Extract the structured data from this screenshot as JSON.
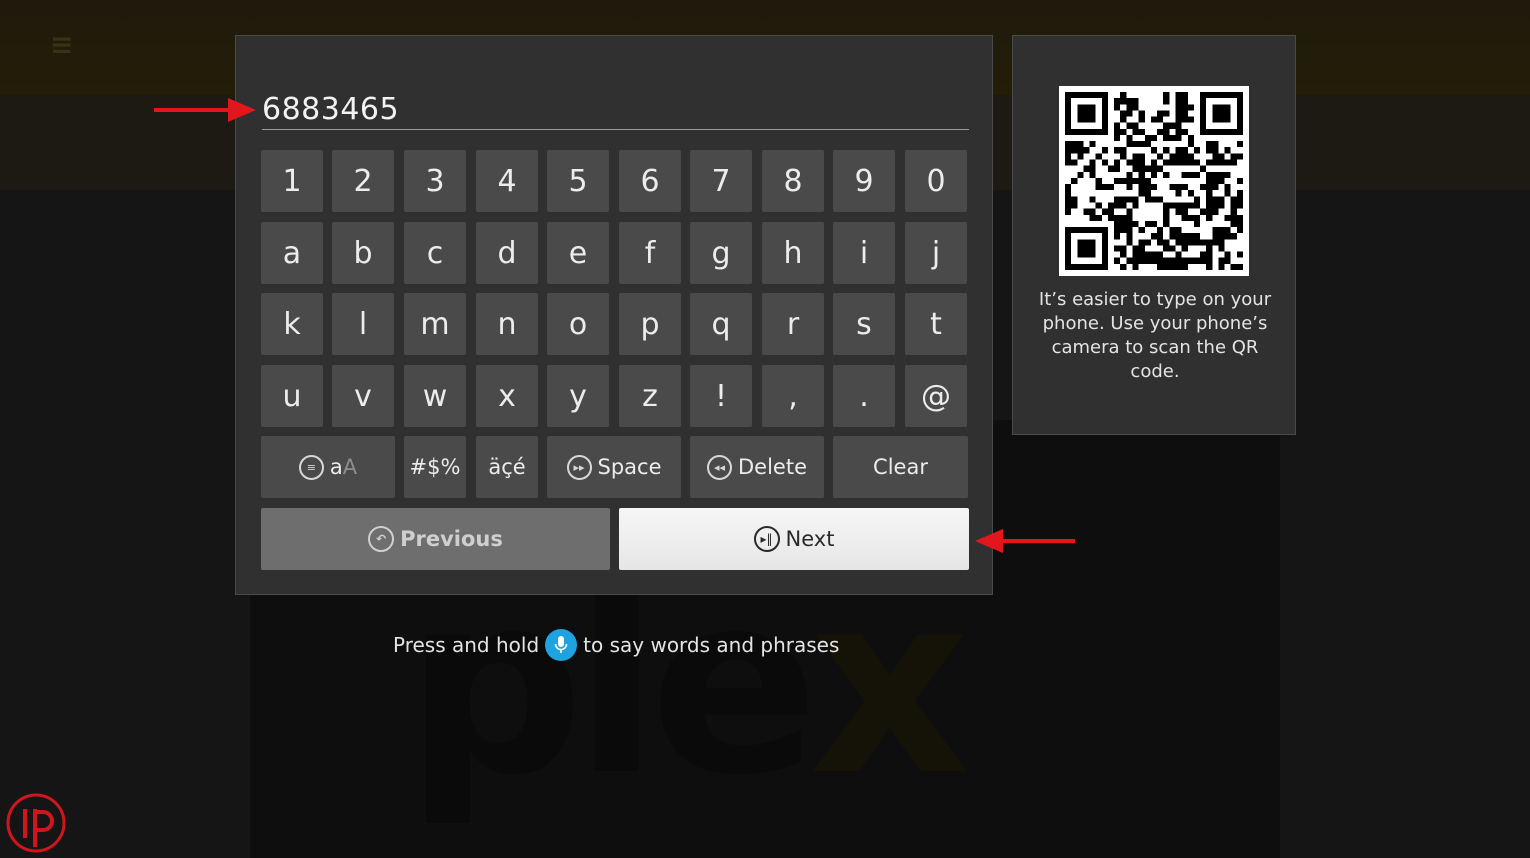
{
  "entry": {
    "value": "6883465"
  },
  "keyboard": {
    "rows": [
      [
        "1",
        "2",
        "3",
        "4",
        "5",
        "6",
        "7",
        "8",
        "9",
        "0"
      ],
      [
        "a",
        "b",
        "c",
        "d",
        "e",
        "f",
        "g",
        "h",
        "i",
        "j"
      ],
      [
        "k",
        "l",
        "m",
        "n",
        "o",
        "p",
        "q",
        "r",
        "s",
        "t"
      ],
      [
        "u",
        "v",
        "w",
        "x",
        "y",
        "z",
        "!",
        ",",
        ".",
        "@"
      ]
    ],
    "case_label_lower": "a",
    "case_label_upper": "A",
    "symbols_label": "#$%",
    "accents_label": "äçé",
    "space_label": "Space",
    "delete_label": "Delete",
    "clear_label": "Clear",
    "previous_label": "Previous",
    "next_label": "Next"
  },
  "qr_panel": {
    "text": "It’s easier to type on your phone. Use your phone’s camera to scan the QR code."
  },
  "voice_hint": {
    "before": "Press and hold",
    "after": "to say words and phrases"
  },
  "colors": {
    "dialog_bg": "#303030",
    "key_bg": "#4a4a4a",
    "next_bg": "#f0f0f0",
    "previous_bg": "#6e6e6e",
    "mic_blue": "#1fa3e0",
    "annotation_red": "#e3161c"
  },
  "icons": {
    "case_toggle": "menu-circle-icon",
    "space": "fast-forward-circle-icon",
    "delete": "rewind-circle-icon",
    "previous": "back-circle-icon",
    "next": "play-pause-circle-icon",
    "voice": "microphone-icon"
  }
}
